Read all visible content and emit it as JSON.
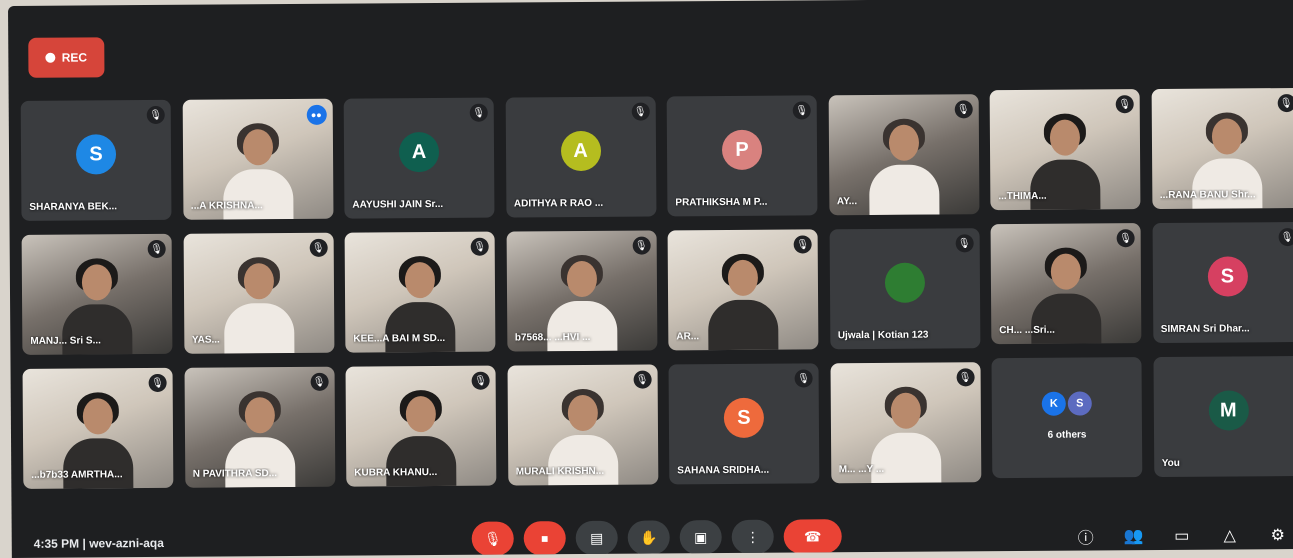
{
  "rec_label": "REC",
  "clock": "4:35 PM",
  "meeting_code": "wev-azni-aqa",
  "colors": {
    "rec": "#d6453a",
    "end_call": "#ea4335",
    "talking": "#1a73e8"
  },
  "tiles": [
    {
      "name": "SHARANYA BEK...",
      "type": "avatar",
      "initial": "S",
      "color": "#1e88e5"
    },
    {
      "name": "...A KRISHNA...",
      "type": "video",
      "speaking": true
    },
    {
      "name": "AAYUSHI JAIN Sr...",
      "type": "avatar",
      "initial": "A",
      "color": "#0f5f4f"
    },
    {
      "name": "ADITHYA R RAO ...",
      "type": "avatar",
      "initial": "A",
      "color": "#b5bd1f"
    },
    {
      "name": "PRATHIKSHA M P...",
      "type": "avatar",
      "initial": "P",
      "color": "#d9827f"
    },
    {
      "name": "AY...",
      "type": "video"
    },
    {
      "name": "...THIMA...",
      "type": "video"
    },
    {
      "name": "...RANA BANU Shr...",
      "type": "video"
    },
    {
      "name": "MANJ... Sri S...",
      "type": "video"
    },
    {
      "name": "YAS...",
      "type": "video"
    },
    {
      "name": "KEE...A BAI M SD...",
      "type": "video"
    },
    {
      "name": "b7568... ...HVI ...",
      "type": "video"
    },
    {
      "name": "AR...",
      "type": "video"
    },
    {
      "name": "Ujwala | Kotian 123",
      "type": "avatar",
      "initial": "",
      "color": "#2e7d32"
    },
    {
      "name": "CH... ...Sri...",
      "type": "video"
    },
    {
      "name": "SIMRAN Sri Dhar...",
      "type": "avatar",
      "initial": "S",
      "color": "#d64061"
    },
    {
      "name": "...b7b33 AMRTHA...",
      "type": "video"
    },
    {
      "name": "N PAVITHRA SD...",
      "type": "video"
    },
    {
      "name": "KUBRA KHANU...",
      "type": "video"
    },
    {
      "name": "MURALI KRISHN...",
      "type": "video"
    },
    {
      "name": "SAHANA SRIDHA...",
      "type": "avatar",
      "initial": "S",
      "color": "#ee6a3c"
    },
    {
      "name": "M... ...Y ...",
      "type": "video"
    },
    {
      "name": "6 others",
      "type": "others",
      "initials": [
        "K",
        "S"
      ]
    },
    {
      "name": "You",
      "type": "avatar",
      "initial": "M",
      "color": "#1a5a47"
    }
  ],
  "controls": {
    "mic": "mic-off-icon",
    "camera": "camera-off-icon",
    "captions": "captions-icon",
    "raise_hand": "hand-icon",
    "present": "present-icon",
    "more": "more-icon",
    "end": "end-call-icon"
  }
}
